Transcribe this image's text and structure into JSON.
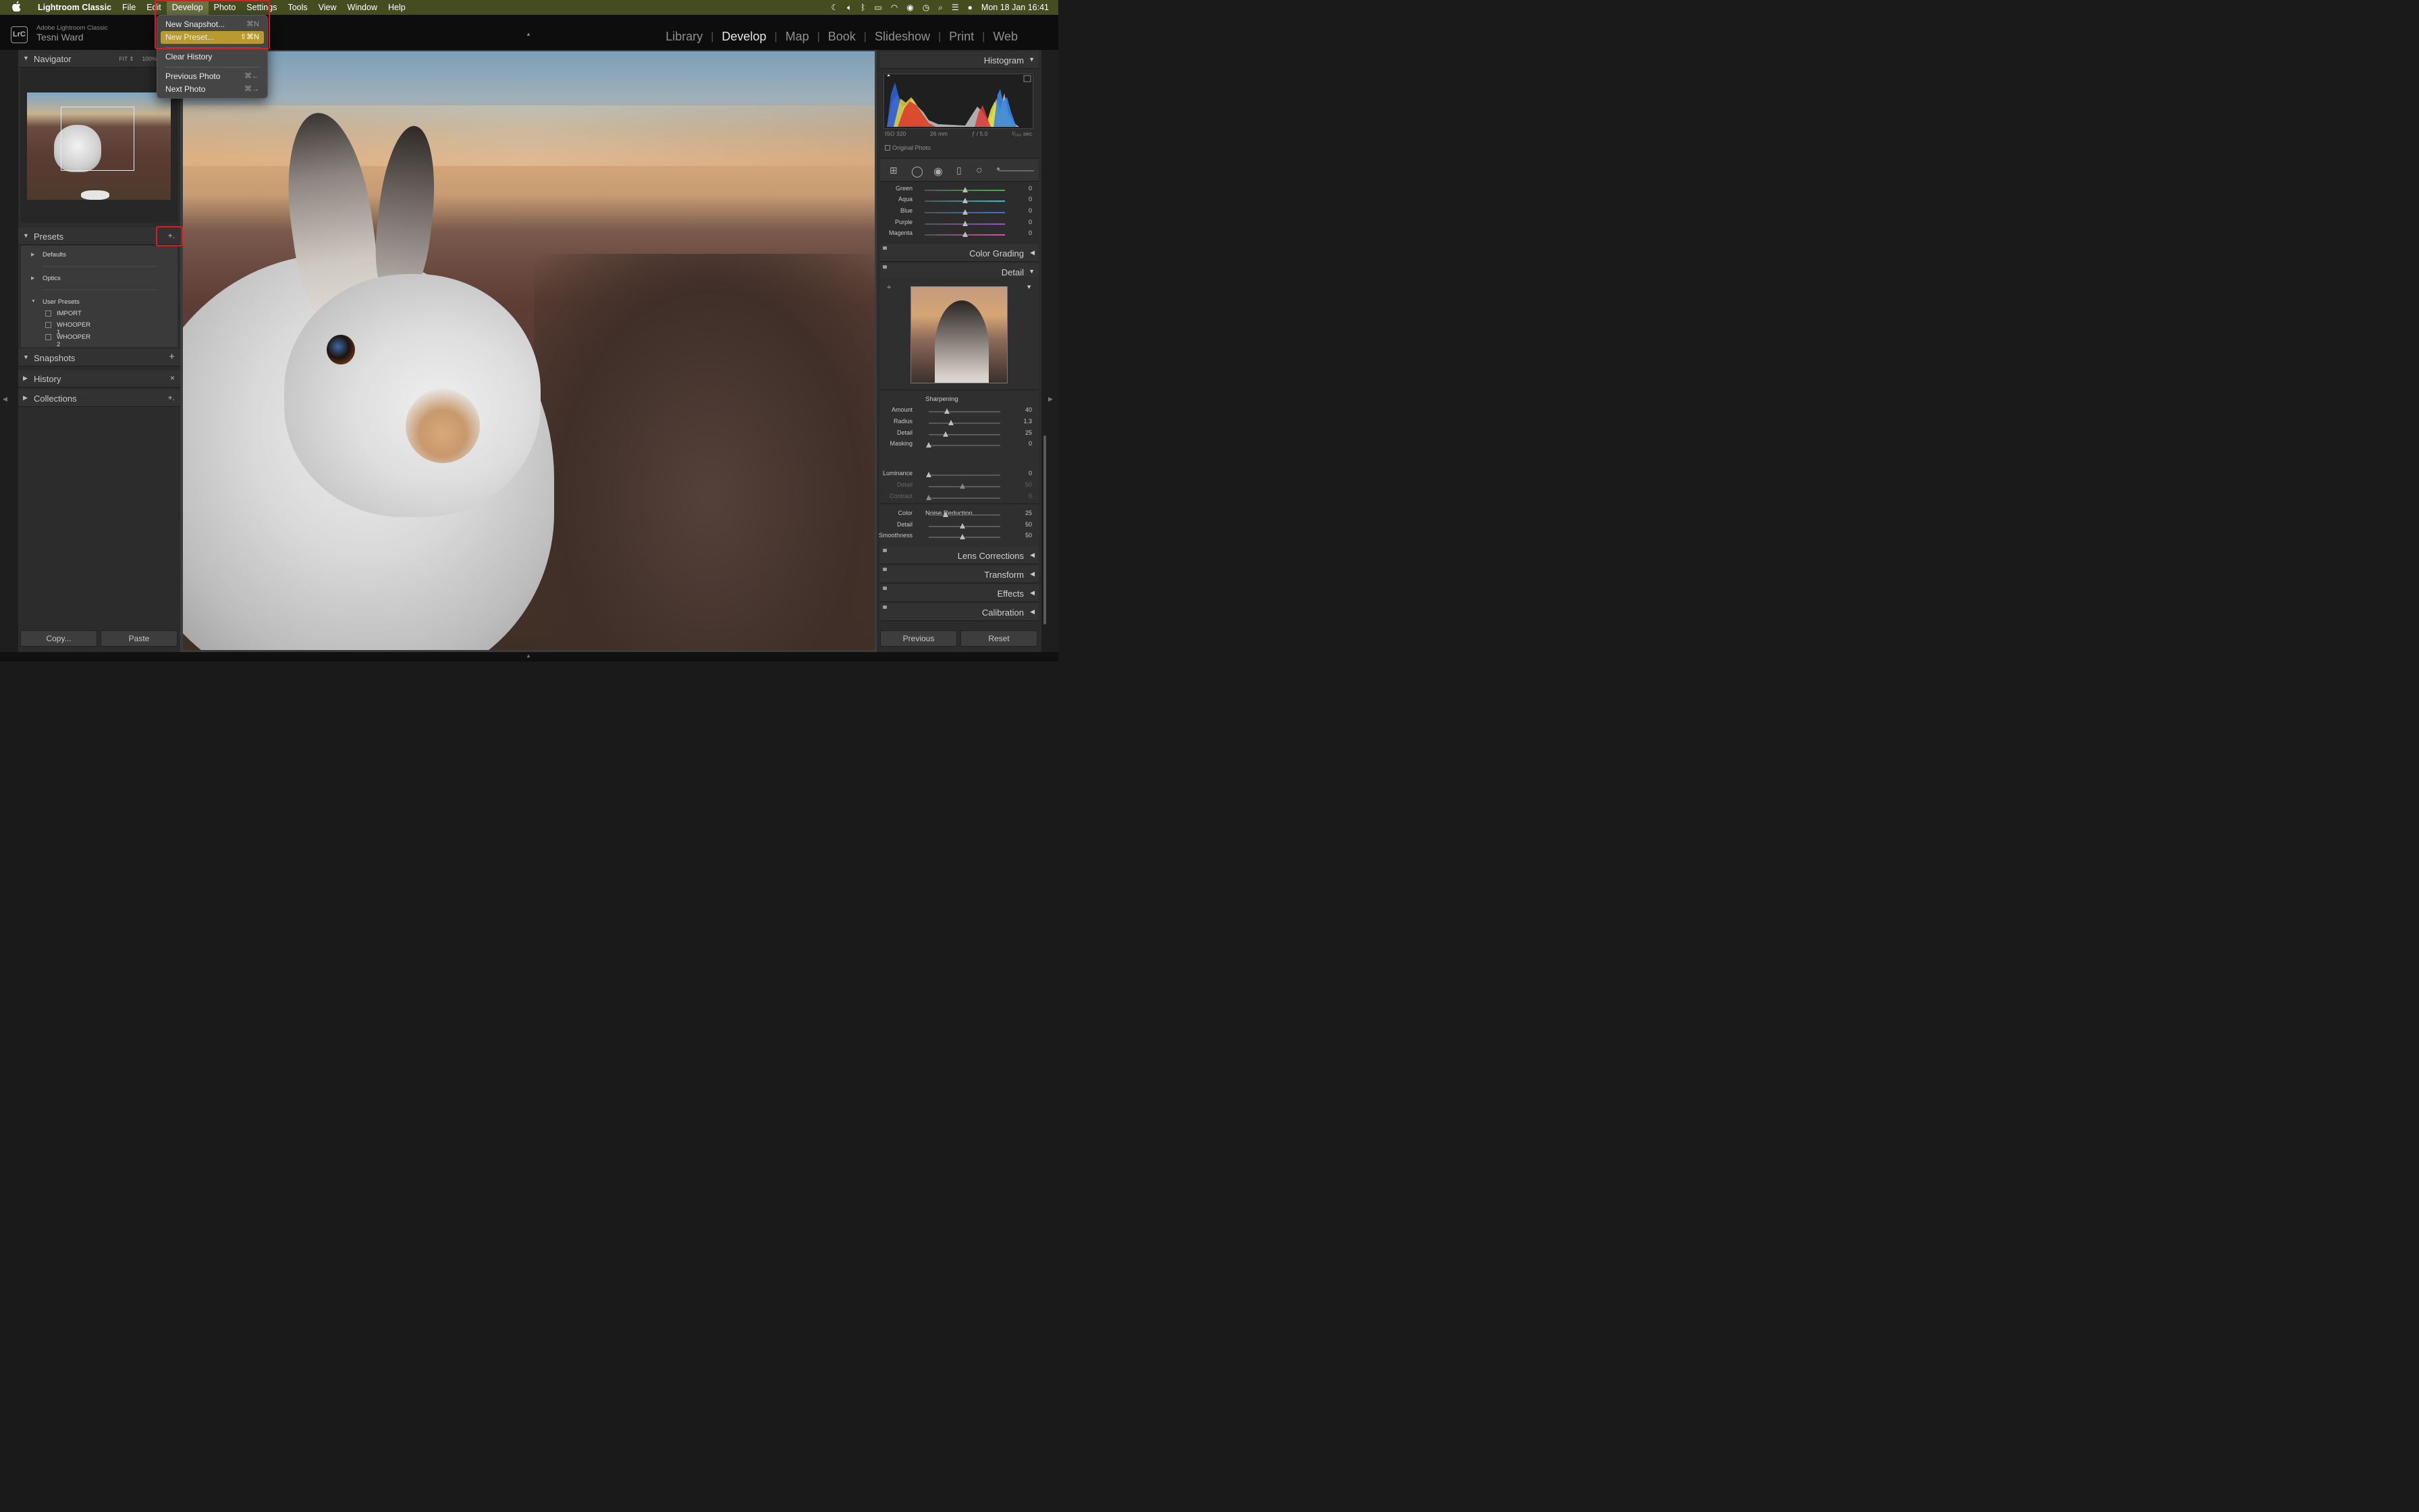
{
  "menubar": {
    "app_name": "Lightroom Classic",
    "items": [
      "File",
      "Edit",
      "Develop",
      "Photo",
      "Settings",
      "Tools",
      "View",
      "Window",
      "Help"
    ],
    "active_item": "Develop",
    "datetime": "Mon 18 Jan  16:41"
  },
  "dropdown": {
    "items": [
      {
        "label": "New Snapshot...",
        "shortcut": "⌘N"
      },
      {
        "label": "New Preset...",
        "shortcut": "⇧⌘N",
        "highlighted": true
      },
      {
        "label": "Clear History",
        "shortcut": ""
      },
      {
        "label": "Previous Photo",
        "shortcut": "⌘←"
      },
      {
        "label": "Next Photo",
        "shortcut": "⌘→"
      }
    ]
  },
  "identity": {
    "app": "Adobe Lightroom Classic",
    "user": "Tesni Ward",
    "logo": "LrC"
  },
  "modules": [
    "Library",
    "Develop",
    "Map",
    "Book",
    "Slideshow",
    "Print",
    "Web"
  ],
  "active_module": "Develop",
  "left": {
    "navigator": {
      "title": "Navigator",
      "fit": "FIT ⇕",
      "zoom": "100%",
      "extra": "2"
    },
    "presets": {
      "title": "Presets",
      "add_icon": "+.",
      "groups": [
        "Defaults",
        "Optics",
        "User Presets"
      ],
      "user_presets": [
        "IMPORT",
        "WHOOPER 1",
        "WHOOPER 2"
      ]
    },
    "snapshots": {
      "title": "Snapshots",
      "action": "+"
    },
    "history": {
      "title": "History",
      "action": "×"
    },
    "collections": {
      "title": "Collections",
      "action": "+."
    },
    "copy_label": "Copy...",
    "paste_label": "Paste"
  },
  "right": {
    "histogram": {
      "title": "Histogram",
      "iso": "ISO 320",
      "focal": "26 mm",
      "aperture": "ƒ / 5.0",
      "shutter": "¹⁄₁₆₀ sec",
      "original_photo": "Original Photo"
    },
    "hsl_rows": [
      {
        "label": "Green",
        "value": "0",
        "color": "#4caf50"
      },
      {
        "label": "Aqua",
        "value": "0",
        "color": "#26c6da"
      },
      {
        "label": "Blue",
        "value": "0",
        "color": "#3f6fd8"
      },
      {
        "label": "Purple",
        "value": "0",
        "color": "#9c4fd8"
      },
      {
        "label": "Magenta",
        "value": "0",
        "color": "#d84fb0"
      }
    ],
    "color_grading": "Color Grading",
    "detail": {
      "title": "Detail",
      "sharpening": {
        "title": "Sharpening",
        "rows": [
          {
            "label": "Amount",
            "value": "40",
            "pos": 0.27
          },
          {
            "label": "Radius",
            "value": "1.3",
            "pos": 0.33
          },
          {
            "label": "Detail",
            "value": "25",
            "pos": 0.25
          },
          {
            "label": "Masking",
            "value": "0",
            "pos": 0.0
          }
        ]
      },
      "noise": {
        "title": "Noise Reduction",
        "rows": [
          {
            "label": "Luminance",
            "value": "0",
            "pos": 0.0
          },
          {
            "label": "Detail",
            "value": "50",
            "pos": 0.5
          },
          {
            "label": "Contrast",
            "value": "0",
            "pos": 0.0
          },
          {
            "label": "Color",
            "value": "25",
            "pos": 0.25
          },
          {
            "label": "Detail",
            "value": "50",
            "pos": 0.5
          },
          {
            "label": "Smoothness",
            "value": "50",
            "pos": 0.5
          }
        ]
      }
    },
    "panels": [
      "Lens Corrections",
      "Transform",
      "Effects",
      "Calibration"
    ],
    "previous_label": "Previous",
    "reset_label": "Reset"
  }
}
